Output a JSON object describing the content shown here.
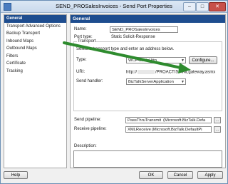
{
  "window": {
    "title": "SEND_PROSalesInvoices - Send Port Properties",
    "controls": {
      "minimize": "–",
      "maximize": "□",
      "close": "✕"
    }
  },
  "nav": {
    "items": [
      {
        "label": "General",
        "active": true
      },
      {
        "label": "Transport Advanced Options"
      },
      {
        "label": "Backup Transport"
      },
      {
        "label": "Inbound Maps"
      },
      {
        "label": "Outbound Maps"
      },
      {
        "label": "Filters"
      },
      {
        "label": "Certificate"
      },
      {
        "label": "Tracking"
      }
    ]
  },
  "panel": {
    "header": "General",
    "name_label": "Name:",
    "name_value": "SEND_PROSalesInvoices",
    "port_type_label": "Port type:",
    "port_type_value": "Static Solicit-Response",
    "transport_group": "Transport",
    "transport_hint": "Select a transport type and enter an address below.",
    "type_label": "Type:",
    "type_value": "WCF-BasicHttp",
    "configure_button": "Configure...",
    "uri_label": "URI:",
    "uri_prefix": "http://",
    "uri_suffix": "/PROACTIS/XMLgateway.asmx",
    "send_handler_label": "Send handler:",
    "send_handler_value": "BizTalkServerApplication",
    "send_pipeline_label": "Send pipeline:",
    "send_pipeline_value": "PassThruTransmit",
    "send_pipeline_assembly": "(Microsoft.BizTalk.Defa",
    "receive_pipeline_label": "Receive pipeline:",
    "receive_pipeline_value": "XMLReceive",
    "receive_pipeline_assembly": "(Microsoft.BizTalk.DefaultPi",
    "ellipsis": "...",
    "description_label": "Description:"
  },
  "footer": {
    "help": "Help",
    "ok": "OK",
    "cancel": "Cancel",
    "apply": "Apply"
  },
  "colors": {
    "header_blue": "#1e4d8f",
    "annotation_arrow": "#2e8b2e"
  }
}
